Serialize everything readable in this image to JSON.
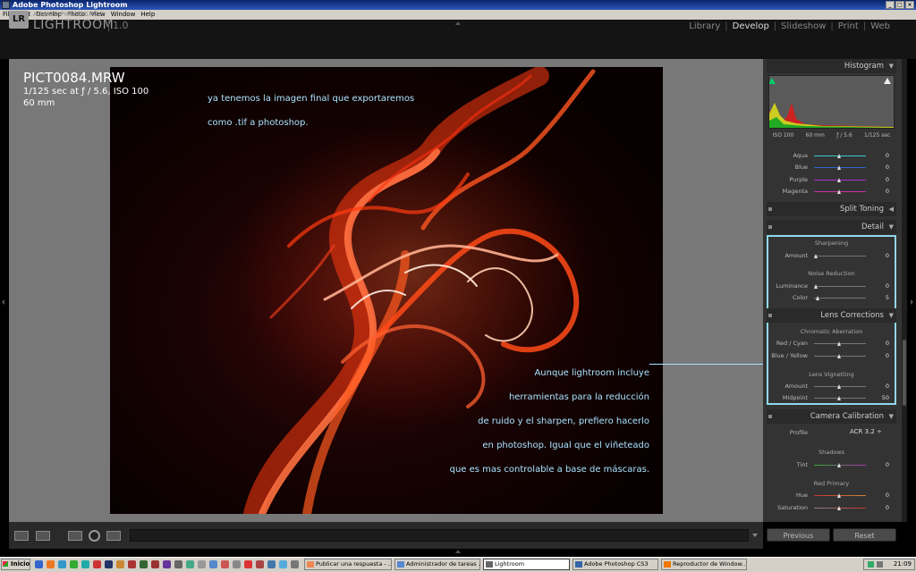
{
  "window": {
    "title": "Adobe Photoshop Lightroom"
  },
  "menu": [
    "File",
    "Edit",
    "Develop",
    "Photo",
    "View",
    "Window",
    "Help"
  ],
  "logo": {
    "badge": "LR",
    "adobe": "ADOBE PHOTOSHOP",
    "product": "LIGHTROOM",
    "version": "1.0"
  },
  "modules": [
    {
      "label": "Library",
      "active": false
    },
    {
      "label": "Develop",
      "active": true
    },
    {
      "label": "Slideshow",
      "active": false
    },
    {
      "label": "Print",
      "active": false
    },
    {
      "label": "Web",
      "active": false
    }
  ],
  "photo": {
    "filename": "PICT0084.MRW",
    "exposure": "1/125 sec at ƒ / 5.6, ISO 100",
    "focal": "60 mm"
  },
  "captions": {
    "top": [
      "ya tenemos la imagen final que exportaremos",
      "como .tif a photoshop."
    ],
    "bottom": [
      "Aunque lightroom incluye",
      "herramientas para la reducción",
      "de ruido y el sharpen, prefiero hacerlo",
      "en photoshop. Igual que el viñeteado",
      "que es mas controlable a base de máscaras."
    ]
  },
  "histogram": {
    "label": "Histogram",
    "info": [
      "ISO 100",
      "60 mm",
      "ƒ / 5.6",
      "1/125 sec"
    ]
  },
  "hsl": [
    {
      "label": "Aqua",
      "value": "0",
      "color": "#3cc"
    },
    {
      "label": "Blue",
      "value": "0",
      "color": "#36c"
    },
    {
      "label": "Purple",
      "value": "0",
      "color": "#a3c"
    },
    {
      "label": "Magenta",
      "value": "0",
      "color": "#c3a"
    }
  ],
  "panels": {
    "split_toning": "Split Toning",
    "detail": "Detail",
    "lens": "Lens Corrections",
    "camera": "Camera Calibration"
  },
  "detail": {
    "sharpening": "Sharpening",
    "amount": {
      "label": "Amount",
      "value": "0"
    },
    "noise": "Noise Reduction",
    "luminance": {
      "label": "Luminance",
      "value": "0"
    },
    "color": {
      "label": "Color",
      "value": "5"
    }
  },
  "lens": {
    "chromatic": "Chromatic Aberration",
    "redcyan": {
      "label": "Red / Cyan",
      "value": "0"
    },
    "blueyellow": {
      "label": "Blue / Yellow",
      "value": "0"
    },
    "vignetting": "Lens Vignetting",
    "amount": {
      "label": "Amount",
      "value": "0"
    },
    "midpoint": {
      "label": "Midpoint",
      "value": "50"
    }
  },
  "calibration": {
    "profile": {
      "label": "Profile",
      "value": "ACR 3.2 ÷"
    },
    "shadows": "Shadows",
    "tint": {
      "label": "Tint",
      "value": "0"
    },
    "redprimary": "Red Primary",
    "hue": {
      "label": "Hue",
      "value": "0"
    },
    "saturation": {
      "label": "Saturation",
      "value": "0"
    }
  },
  "buttons": {
    "previous": "Previous",
    "reset": "Reset"
  },
  "taskbar": {
    "start": "Inicio",
    "tasks": [
      {
        "label": "Publicar una respuesta - ...",
        "active": false,
        "color": "#e85"
      },
      {
        "label": "Administrador de tareas ...",
        "active": false,
        "color": "#58c"
      },
      {
        "label": "Lightroom",
        "active": true,
        "color": "#666"
      },
      {
        "label": "Adobe Photoshop CS3",
        "active": false,
        "color": "#36a"
      },
      {
        "label": "Reproductor de Window...",
        "active": false,
        "color": "#e70"
      }
    ],
    "clock": "21:09"
  }
}
